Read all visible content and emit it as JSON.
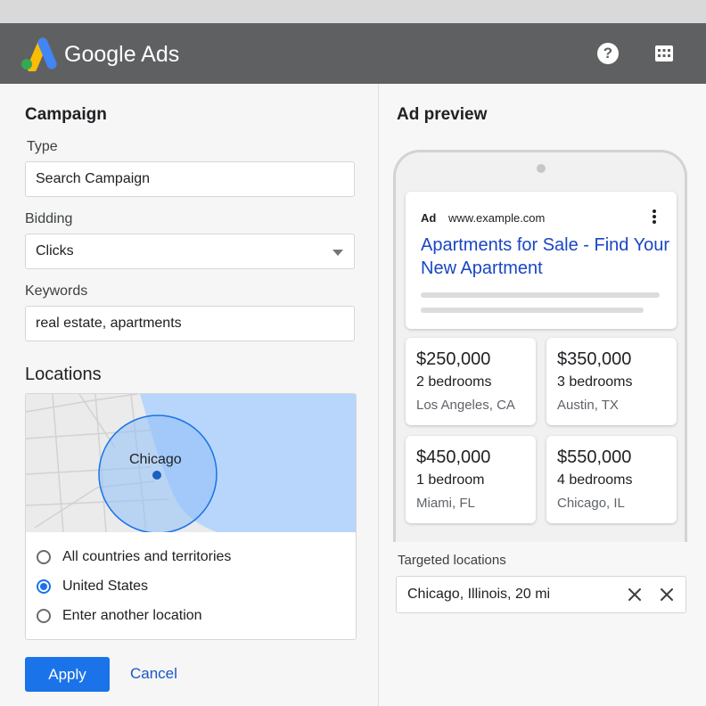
{
  "app": {
    "brand": "Google Ads",
    "help_icon": "help-icon",
    "apps_icon": "apps-grid-icon",
    "help_glyph": "?"
  },
  "campaign": {
    "title": "Campaign",
    "type_label": "Type",
    "type_value": "Search Campaign",
    "bidding_label": "Bidding",
    "bidding_value": "Clicks",
    "keywords_label": "Keywords",
    "keywords_value": "real estate, apartments"
  },
  "locations": {
    "title": "Locations",
    "map_city": "Chicago",
    "options": [
      {
        "label": "All countries and territories",
        "selected": false
      },
      {
        "label": "United States",
        "selected": true
      },
      {
        "label": "Enter another location",
        "selected": false
      }
    ]
  },
  "actions": {
    "apply": "Apply",
    "cancel": "Cancel"
  },
  "preview": {
    "title": "Ad preview",
    "ad_tag": "Ad",
    "url": "www.example.com",
    "headline": "Apartments for Sale - Find Your New Apartment",
    "listings": [
      {
        "price": "$250,000",
        "beds": "2 bedrooms",
        "city": "Los Angeles, CA"
      },
      {
        "price": "$350,000",
        "beds": "3 bedrooms",
        "city": "Austin, TX"
      },
      {
        "price": "$450,000",
        "beds": "1 bedroom",
        "city": "Miami, FL"
      },
      {
        "price": "$550,000",
        "beds": "4 bedrooms",
        "city": "Chicago, IL"
      }
    ],
    "targeted_label": "Targeted locations",
    "targeted_value": "Chicago, Illinois, 20 mi"
  },
  "colors": {
    "accent": "#1a73e8",
    "appbar": "#5f6062",
    "headline": "#1a46c4"
  }
}
